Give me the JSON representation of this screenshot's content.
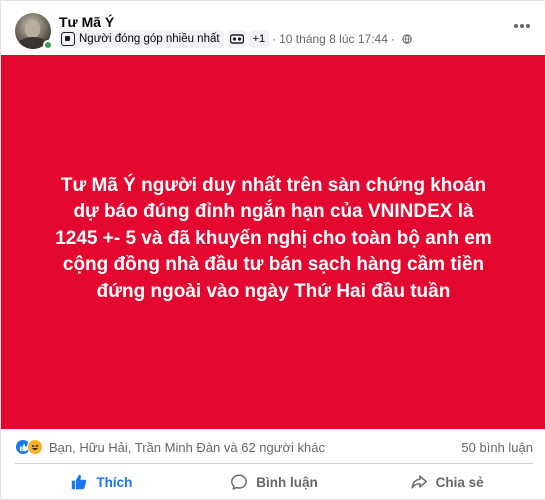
{
  "post": {
    "author": "Tư Mã Ý",
    "badge_label": "Người đóng góp nhiều nhất",
    "extra_badges": "+1",
    "separator": "·",
    "timestamp": "10 tháng 8 lúc 17:44",
    "separator2": "·",
    "body": "Tư Mã Ý người duy nhất trên sàn chứng khoán dự báo đúng đỉnh ngắn hạn của VNINDEX là 1245 +- 5 và đã khuyến nghị cho toàn bộ anh em cộng đồng nhà đầu tư bán sạch hàng cầm tiền đứng ngoài vào ngày Thứ Hai đầu tuần",
    "background_color": "#e4072f",
    "more_icon": "more-horizontal-icon"
  },
  "stats": {
    "reactions": [
      "like",
      "haha"
    ],
    "reactors_text": "Bạn, Hữu Hải, Trần Minh Đàn và 62 người khác",
    "comments_text": "50 bình luận"
  },
  "actions": {
    "like_label": "Thích",
    "comment_label": "Bình luận",
    "share_label": "Chia sẻ"
  },
  "colors": {
    "accent": "#1877f2",
    "online": "#31a24c",
    "muted": "#65676b"
  }
}
